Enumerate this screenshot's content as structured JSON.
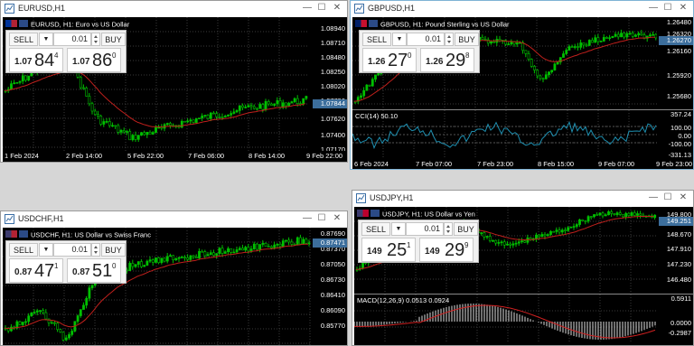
{
  "colors": {
    "bull": "#00c000",
    "bear": "#00c000",
    "ma": "#c0201c",
    "cci": "#1e8fb0",
    "macd": "#b8b8b8",
    "signal": "#d02020",
    "grid": "#3a3a3a"
  },
  "ui": {
    "sell_label": "SELL",
    "buy_label": "BUY",
    "lot": "0.01",
    "min": "—",
    "max": "☐",
    "close": "✕"
  },
  "windows": [
    {
      "id": "eurusd",
      "title": "EURUSD,H1",
      "desc": "EURUSD, H1:  Euro vs US Dollar",
      "sell": {
        "pre": "1.07",
        "big": "84",
        "sup": "4"
      },
      "buy": {
        "pre": "1.07",
        "big": "86",
        "sup": "0"
      },
      "yticks": [
        "1.08940",
        "1.08710",
        "1.08480",
        "1.08250",
        "1.08020",
        "1.07790",
        "1.07620",
        "1.07400",
        "1.07170"
      ],
      "current": "1.07844",
      "xticks": [
        "1 Feb 2024",
        "2 Feb 14:00",
        "5 Feb 22:00",
        "7 Feb 06:00",
        "8 Feb 14:00",
        "9 Feb 22:00"
      ]
    },
    {
      "id": "gbpusd",
      "title": "GBPUSD,H1",
      "desc": "GBPUSD, H1:  Pound Sterling vs US Dollar",
      "sell": {
        "pre": "1.26",
        "big": "27",
        "sup": "0"
      },
      "buy": {
        "pre": "1.26",
        "big": "29",
        "sup": "8"
      },
      "yticks": [
        "1.26480",
        "1.26320",
        "1.26160",
        "1.25920",
        "1.25680"
      ],
      "current": "1.26270",
      "cci_label": "CCI(14) 50.10",
      "cci_ticks": [
        "357.24",
        "100.00",
        "0.00",
        "-100.00",
        "-331.13"
      ],
      "xticks": [
        "6 Feb 2024",
        "7 Feb 07:00",
        "7 Feb 23:00",
        "8 Feb 15:00",
        "9 Feb 07:00",
        "9 Feb 23:00"
      ]
    },
    {
      "id": "usdchf",
      "title": "USDCHF,H1",
      "desc": "USDCHF, H1:  US Dollar vs Swiss Franc",
      "sell": {
        "pre": "0.87",
        "big": "47",
        "sup": "1"
      },
      "buy": {
        "pre": "0.87",
        "big": "51",
        "sup": "0"
      },
      "yticks": [
        "0.87690",
        "0.87370",
        "0.87050",
        "0.86730",
        "0.86410",
        "0.86090",
        "0.85770"
      ],
      "current": "0.87471",
      "xticks": []
    },
    {
      "id": "usdjpy",
      "title": "USDJPY,H1",
      "desc": "USDJPY, H1:  US Dollar vs Yen",
      "sell": {
        "pre": "149",
        "big": "25",
        "sup": "1"
      },
      "buy": {
        "pre": "149",
        "big": "29",
        "sup": "9"
      },
      "yticks": [
        "149.800",
        "148.670",
        "147.910",
        "147.230",
        "146.480"
      ],
      "current": "149.251",
      "macd_label": "MACD(12,26,9) 0.0513 0.0924",
      "macd_ticks": [
        "0.5911",
        "0.0000",
        "-0.2987"
      ],
      "xticks": []
    }
  ]
}
